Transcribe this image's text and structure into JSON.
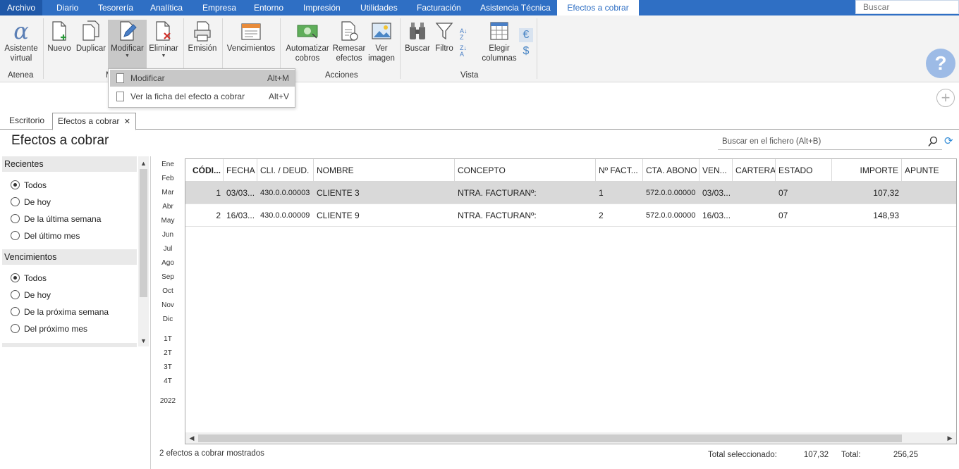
{
  "menubar": {
    "items": [
      "Archivo",
      "Diario",
      "Tesorería",
      "Analítica",
      "Empresa",
      "Entorno",
      "Impresión",
      "Utilidades",
      "Facturación",
      "Asistencia Técnica",
      "Efectos a cobrar"
    ],
    "search_placeholder": "Buscar",
    "accent": "#2f6fc4"
  },
  "ribbon": {
    "buttons": [
      {
        "label": "Asistente\nvirtual",
        "icon": "alpha-assistant-icon"
      },
      {
        "label": "Nuevo",
        "icon": "new-document-icon"
      },
      {
        "label": "Duplicar",
        "icon": "duplicate-icon"
      },
      {
        "label": "Modificar",
        "icon": "edit-document-icon"
      },
      {
        "label": "Eliminar",
        "icon": "delete-document-icon"
      },
      {
        "label": "Emisión",
        "icon": "print-icon"
      },
      {
        "label": "Vencimientos",
        "icon": "calendar-icon"
      },
      {
        "label": "Automatizar\ncobros",
        "icon": "money-icon"
      },
      {
        "label": "Remesar\nefectos",
        "icon": "remittance-icon"
      },
      {
        "label": "Ver\nimagen",
        "icon": "image-icon"
      },
      {
        "label": "Buscar",
        "icon": "binoculars-icon"
      },
      {
        "label": "Filtro",
        "icon": "filter-icon"
      },
      {
        "label": "Elegir\ncolumnas",
        "icon": "columns-icon"
      }
    ],
    "groups": [
      "Atenea",
      "M",
      "Acciones",
      "Vista"
    ],
    "currency_euro": "€",
    "currency_dollar": "$"
  },
  "dropdown": {
    "items": [
      {
        "label": "Modificar",
        "shortcut": "Alt+M"
      },
      {
        "label": "Ver la ficha del efecto a cobrar",
        "shortcut": "Alt+V"
      }
    ]
  },
  "tabs": [
    {
      "label": "Escritorio"
    },
    {
      "label": "Efectos a cobrar",
      "close": "✕"
    }
  ],
  "page": {
    "title": "Efectos a cobrar",
    "search_placeholder": "Buscar en el fichero (Alt+B)"
  },
  "filters": {
    "recientes_title": "Recientes",
    "recientes": [
      {
        "label": "Todos",
        "checked": true
      },
      {
        "label": "De hoy",
        "checked": false
      },
      {
        "label": "De la última semana",
        "checked": false
      },
      {
        "label": "Del último mes",
        "checked": false
      }
    ],
    "vencimientos_title": "Vencimientos",
    "vencimientos": [
      {
        "label": "Todos",
        "checked": true
      },
      {
        "label": "De hoy",
        "checked": false
      },
      {
        "label": "De la próxima semana",
        "checked": false
      },
      {
        "label": "Del próximo mes",
        "checked": false
      }
    ]
  },
  "periods": {
    "months": [
      "Ene",
      "Feb",
      "Mar",
      "Abr",
      "May",
      "Jun",
      "Jul",
      "Ago",
      "Sep",
      "Oct",
      "Nov",
      "Dic"
    ],
    "quarters": [
      "1T",
      "2T",
      "3T",
      "4T"
    ],
    "year": "2022"
  },
  "table": {
    "columns": [
      "CÓDI...",
      "FECHA",
      "CLI. / DEUD.",
      "NOMBRE",
      "CONCEPTO",
      "Nº FACT...",
      "CTA. ABONO",
      "VEN...",
      "CARTERA",
      "ESTADO",
      "IMPORTE",
      "APUNTE"
    ],
    "rows": [
      [
        "1",
        "03/03...",
        "430.0.0.00003",
        "CLIENTE 3",
        "NTRA. FACTURANº:",
        "1",
        "572.0.0.00000",
        "03/03...",
        "",
        "07",
        "107,32",
        ""
      ],
      [
        "2",
        "16/03...",
        "430.0.0.00009",
        "CLIENTE 9",
        "NTRA. FACTURANº:",
        "2",
        "572.0.0.00000",
        "16/03...",
        "",
        "07",
        "148,93",
        ""
      ]
    ]
  },
  "footer": {
    "count": "2 efectos a cobrar mostrados",
    "selected_label": "Total seleccionado:",
    "selected_value": "107,32",
    "total_label": "Total:",
    "total_value": "256,25"
  }
}
